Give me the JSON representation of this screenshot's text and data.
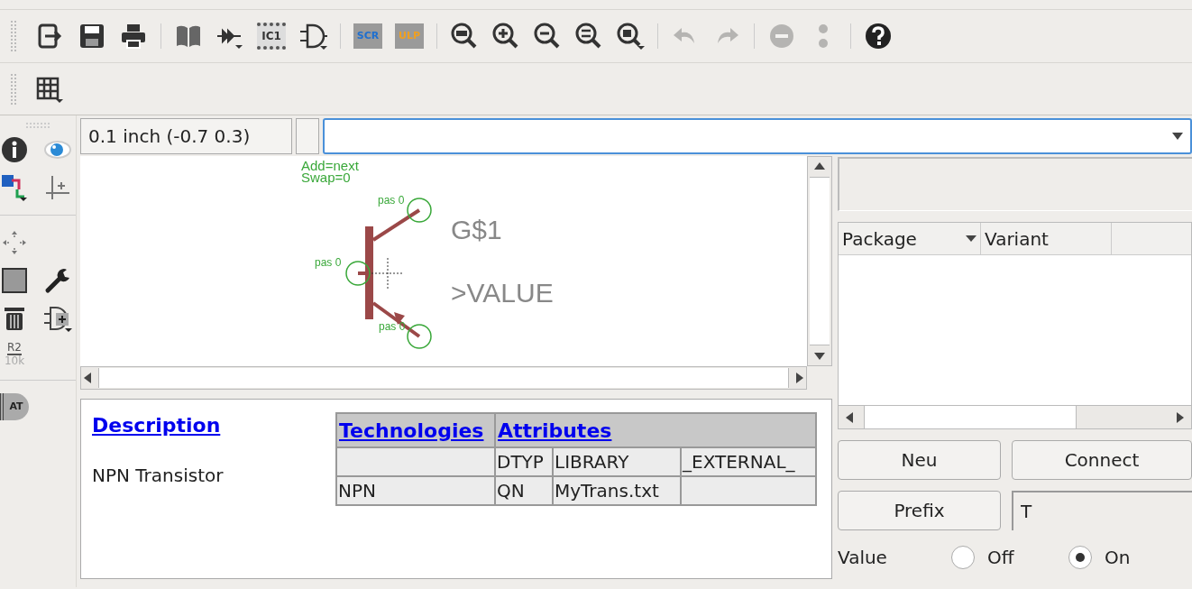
{
  "toolbar": [
    {
      "kind": "export",
      "disabled": false
    },
    {
      "kind": "save",
      "disabled": false
    },
    {
      "kind": "print",
      "disabled": false
    },
    {
      "kind": "sep"
    },
    {
      "kind": "book",
      "disabled": false
    },
    {
      "kind": "pins",
      "disabled": false
    },
    {
      "kind": "chip",
      "label": "IC1",
      "disabled": false
    },
    {
      "kind": "gate",
      "disabled": false
    },
    {
      "kind": "sep"
    },
    {
      "kind": "script",
      "label": "SCR",
      "disabled": false
    },
    {
      "kind": "ulp",
      "label": "ULP",
      "disabled": false
    },
    {
      "kind": "sep"
    },
    {
      "kind": "zoomfit",
      "disabled": false
    },
    {
      "kind": "zoomin",
      "disabled": false
    },
    {
      "kind": "zoomout",
      "disabled": false
    },
    {
      "kind": "redraw",
      "disabled": false
    },
    {
      "kind": "zoomselect",
      "disabled": false
    },
    {
      "kind": "sep"
    },
    {
      "kind": "undo",
      "disabled": true
    },
    {
      "kind": "redo",
      "disabled": true
    },
    {
      "kind": "sep"
    },
    {
      "kind": "stop",
      "disabled": true
    },
    {
      "kind": "go",
      "disabled": true
    },
    {
      "kind": "sep"
    },
    {
      "kind": "help",
      "disabled": false
    }
  ],
  "toolbar2": [
    {
      "kind": "grid",
      "disabled": false
    }
  ],
  "tools": [
    {
      "kind": "info"
    },
    {
      "kind": "show"
    },
    {
      "kind": "layers"
    },
    {
      "kind": "mark"
    },
    {
      "kind": "sep"
    },
    {
      "kind": "move"
    },
    {
      "kind": "group"
    },
    {
      "kind": "change"
    },
    {
      "kind": "delete"
    },
    {
      "kind": "addgate"
    },
    {
      "kind": "value",
      "label": "R2",
      "sublabel": "10k"
    },
    {
      "kind": "sep"
    },
    {
      "kind": "attribute",
      "label": "AT"
    }
  ],
  "coordinates": "0.1 inch (-0.7 0.3)",
  "canvas": {
    "notes": [
      "Add=next",
      "Swap=0"
    ],
    "pins": [
      "pas 0",
      "pas 0",
      "pas 0"
    ],
    "name": "G$1",
    "value": ">VALUE"
  },
  "description": {
    "title": "Description",
    "text": "NPN Transistor"
  },
  "attributes_table": {
    "headers": [
      "Technologies",
      "Attributes"
    ],
    "rows": [
      [
        "",
        "DTYP",
        "LIBRARY",
        "_EXTERNAL_"
      ],
      [
        "NPN",
        "QN",
        "MyTrans.txt",
        ""
      ]
    ]
  },
  "package_table": {
    "columns": [
      "Package",
      "Variant"
    ]
  },
  "buttons": [
    "Neu",
    "Connect",
    "Prefix"
  ],
  "prefix": {
    "value": "T"
  },
  "value_option": {
    "label": "Value",
    "options": [
      {
        "label": "Off",
        "selected": false
      },
      {
        "label": "On",
        "selected": true
      }
    ]
  }
}
